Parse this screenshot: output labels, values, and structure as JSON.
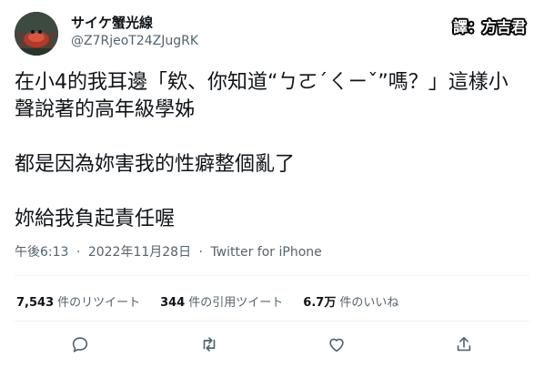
{
  "author": {
    "display_name": "サイケ蟹光線",
    "handle": "@Z7RjeoT24ZJugRK"
  },
  "credit": "譯：方吉君",
  "tweet": {
    "lines": [
      "在小4的我耳邊「欸、你知道“ㄅㄛˊㄑㄧˇ”嗎？」這樣小",
      "聲說著的高年級學姊",
      "都是因為妳害我的性癖整個亂了",
      "妳給我負起責任喔"
    ]
  },
  "meta": {
    "time": "午後6:13",
    "date": "2022年11月28日",
    "source": "Twitter for iPhone",
    "separator": "·"
  },
  "stats": {
    "retweets": {
      "count": "7,543",
      "label": "件のリツイート"
    },
    "quotes": {
      "count": "344",
      "label": "件の引用ツイート"
    },
    "likes": {
      "count": "6.7万",
      "label": "件のいいね"
    }
  },
  "actions": [
    "reply-icon",
    "retweet-icon",
    "like-icon",
    "share-icon"
  ],
  "colors": {
    "text": "#0f1419",
    "secondary": "#536471",
    "divider": "#eff3f4"
  }
}
